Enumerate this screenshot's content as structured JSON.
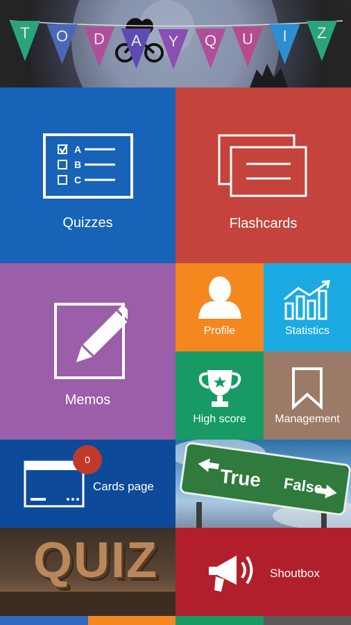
{
  "header": {
    "title_letters": [
      "T",
      "O",
      "D",
      "A",
      "Y",
      "Q",
      "U",
      "I",
      "Z"
    ],
    "flag_colors": [
      "#2aa57b",
      "#4a68b7",
      "#b04f99",
      "#5d4cb1",
      "#8a4fb0",
      "#b04f99",
      "#b64b8d",
      "#2c8fd4",
      "#2aa57b"
    ]
  },
  "tiles": {
    "quizzes": {
      "label": "Quizzes",
      "icon_rows": [
        "A",
        "B",
        "C"
      ]
    },
    "flashcards": {
      "label": "Flashcards"
    },
    "memos": {
      "label": "Memos"
    },
    "profile": {
      "label": "Profile"
    },
    "statistics": {
      "label": "Statistics"
    },
    "highscore": {
      "label": "High score"
    },
    "management": {
      "label": "Management"
    },
    "cards": {
      "label": "Cards page",
      "badge": "0"
    },
    "truefalse": {
      "true_text": "True",
      "false_text": "False"
    },
    "quizimg": {
      "text": "QUIZ"
    },
    "shoutbox": {
      "label": "Shoutbox"
    }
  },
  "colors": {
    "quizzes": "#1663b7",
    "flashcards": "#c4433d",
    "memos": "#9b5ea9",
    "profile": "#f5871f",
    "statistics": "#1caae2",
    "highscore": "#179a64",
    "management": "#9b7a67",
    "cards": "#0d4a9a",
    "shoutbox": "#b11f2d",
    "badge": "#c0392b"
  },
  "bottom_strip_colors": [
    "#2e6bbf",
    "#f5871f",
    "#179a64",
    "#5a5a5a"
  ]
}
